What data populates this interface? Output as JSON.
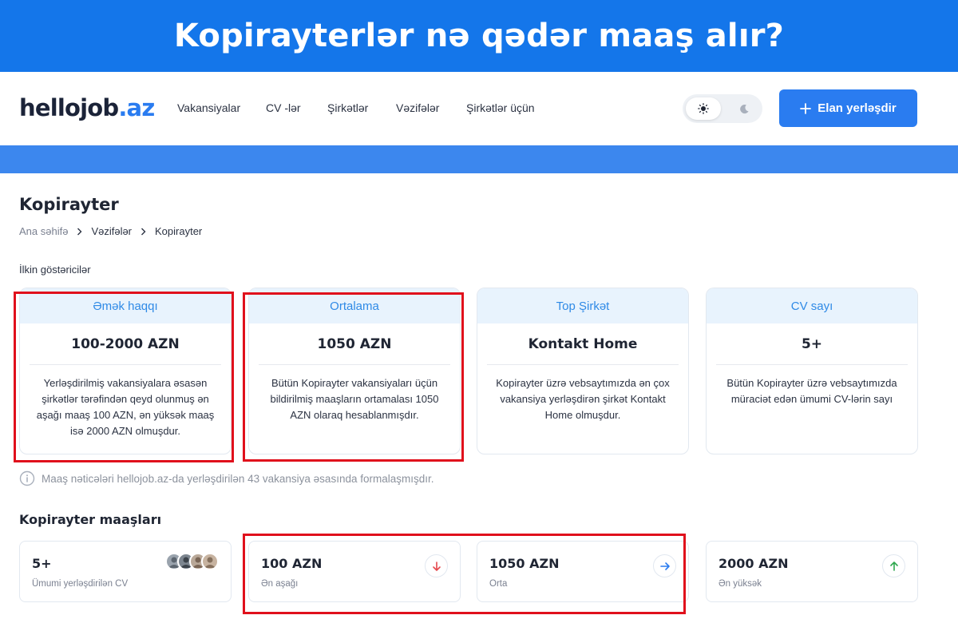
{
  "banner": {
    "title": "Kopirayterlər nə qədər maaş alır?"
  },
  "header": {
    "logo_main": "hellojob",
    "logo_domain": ".az",
    "nav": [
      "Vakansiyalar",
      "CV -lər",
      "Şirkətlər",
      "Vəzifələr",
      "Şirkətlər üçün"
    ],
    "post_button": "Elan yerləşdir",
    "icons": {
      "light": "sun-icon",
      "dark": "moon-icon",
      "add": "plus-icon"
    }
  },
  "page": {
    "title": "Kopirayter",
    "breadcrumb": [
      "Ana səhifə",
      "Vəzifələr",
      "Kopirayter"
    ],
    "section_label": "İlkin göstəricilər"
  },
  "cards": [
    {
      "title": "Əmək haqqı",
      "value": "100-2000 AZN",
      "desc": "Yerləşdirilmiş vakansiyalara əsasən şirkətlər tərəfindən qeyd olunmuş ən aşağı maaş 100 AZN, ən yüksək maaş isə 2000 AZN olmuşdur."
    },
    {
      "title": "Ortalama",
      "value": "1050 AZN",
      "desc": "Bütün Kopirayter vakansiyaları üçün bildirilmiş maaşların ortamalası 1050 AZN olaraq hesablanmışdır."
    },
    {
      "title": "Top Şirkət",
      "value": "Kontakt Home",
      "desc": "Kopirayter üzrə vebsaytımızda ən çox vakansiya yerləşdirən şirkət Kontakt Home olmuşdur."
    },
    {
      "title": "CV sayı",
      "value": "5+",
      "desc": "Bütün Kopirayter üzrə vebsaytımızda müraciət edən ümumi CV-lərin sayı"
    }
  ],
  "note": "Maaş nəticələri hellojob.az-da yerləşdirilən 43 vakansiya əsasında formalaşmışdır.",
  "salary_section": {
    "title": "Kopirayter maaşları"
  },
  "stats": [
    {
      "value": "5+",
      "label": "Ümumi yerləşdirilən CV",
      "icon": "avatars-group"
    },
    {
      "value": "100 AZN",
      "label": "Ən aşağı",
      "icon": "arrow-down-icon",
      "color": "#e5484d"
    },
    {
      "value": "1050 AZN",
      "label": "Orta",
      "icon": "arrow-right-icon",
      "color": "#2a7cf0"
    },
    {
      "value": "2000 AZN",
      "label": "Ən yüksək",
      "icon": "arrow-up-icon",
      "color": "#2fa84f"
    }
  ],
  "colors": {
    "primary": "#2a7cf0",
    "banner": "#1476ea",
    "highlight": "#e0101c"
  }
}
